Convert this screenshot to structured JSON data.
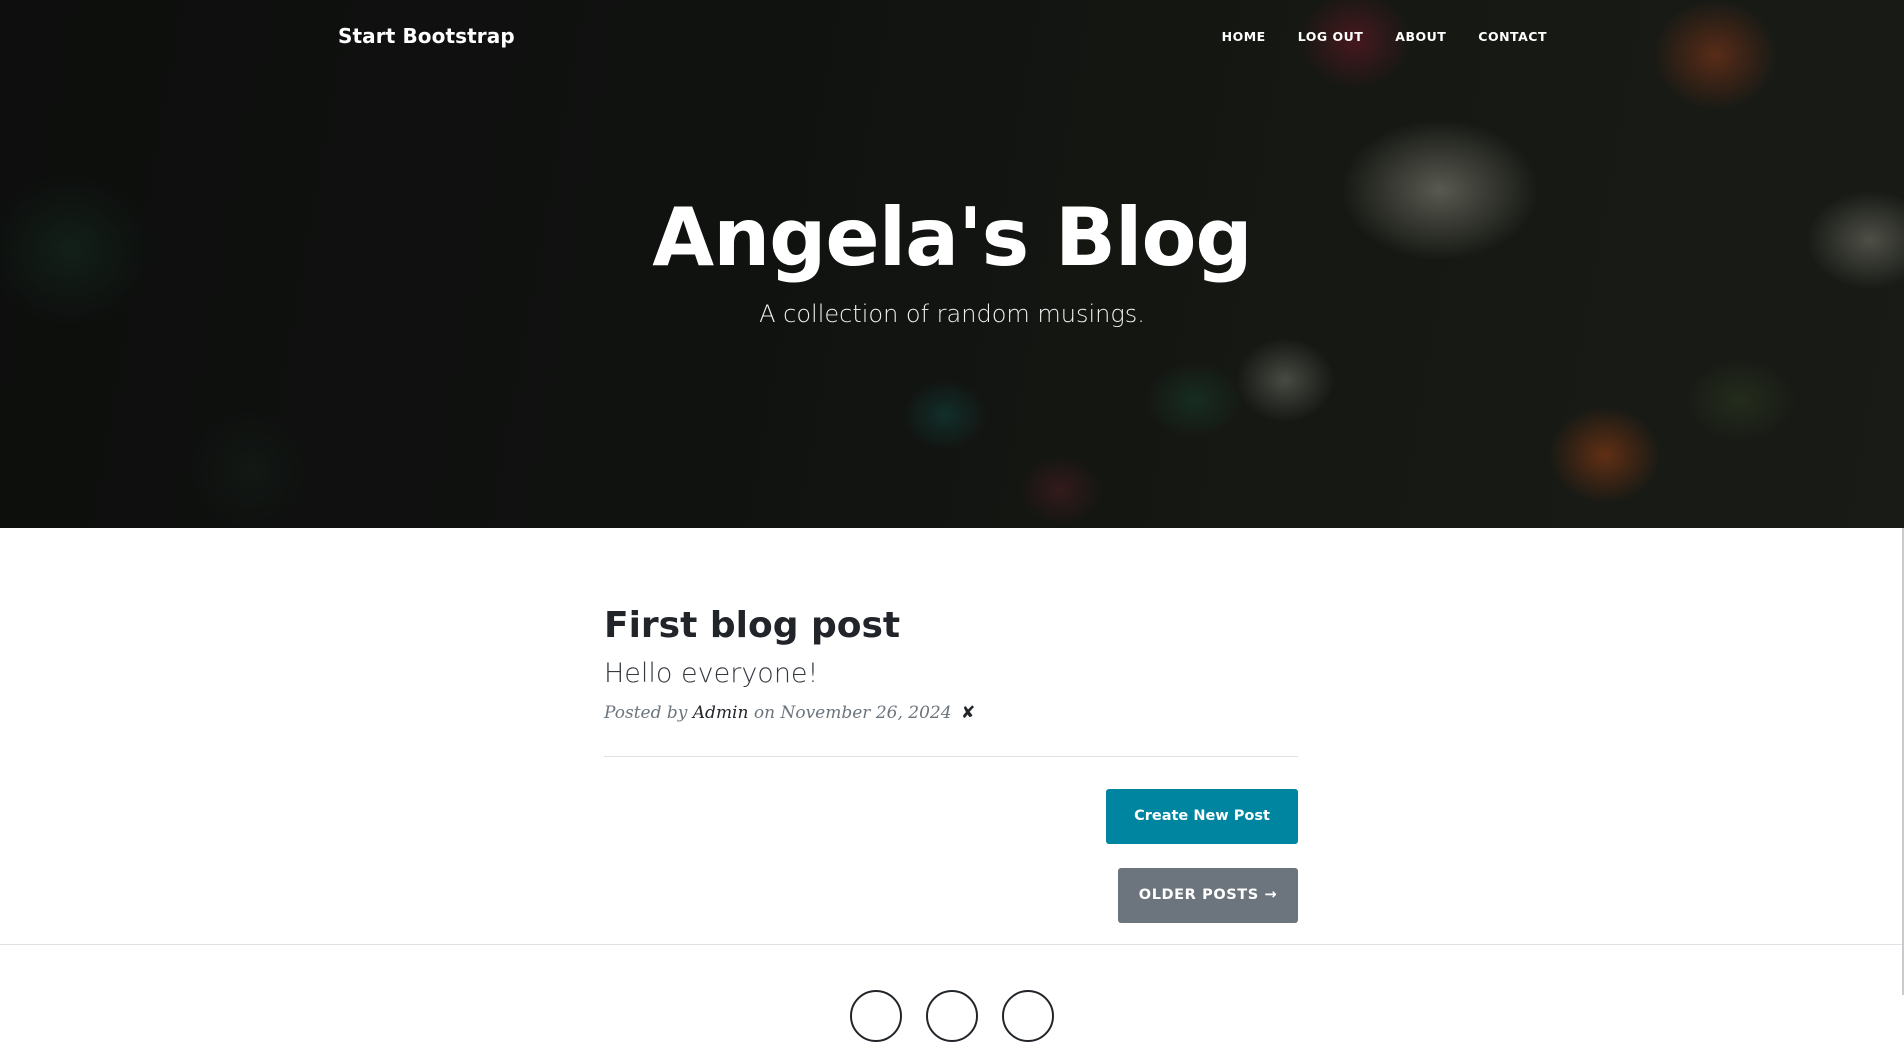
{
  "navbar": {
    "brand": "Start Bootstrap",
    "links": [
      "HOME",
      "LOG OUT",
      "ABOUT",
      "CONTACT"
    ]
  },
  "hero": {
    "title": "Angela's Blog",
    "subtitle": "A collection of random musings."
  },
  "posts": [
    {
      "title": "First blog post",
      "subtitle": "Hello everyone!",
      "meta_prefix": "Posted by",
      "author": "Admin",
      "meta_on": "on",
      "date": "November 26, 2024",
      "delete_symbol": "✘"
    }
  ],
  "buttons": {
    "create": "Create New Post",
    "older": "OLDER POSTS →"
  },
  "colors": {
    "primary": "#0085a1",
    "secondary": "#6c757d"
  },
  "footer": {
    "social_icons": [
      "twitter-icon",
      "facebook-icon",
      "github-icon"
    ]
  }
}
